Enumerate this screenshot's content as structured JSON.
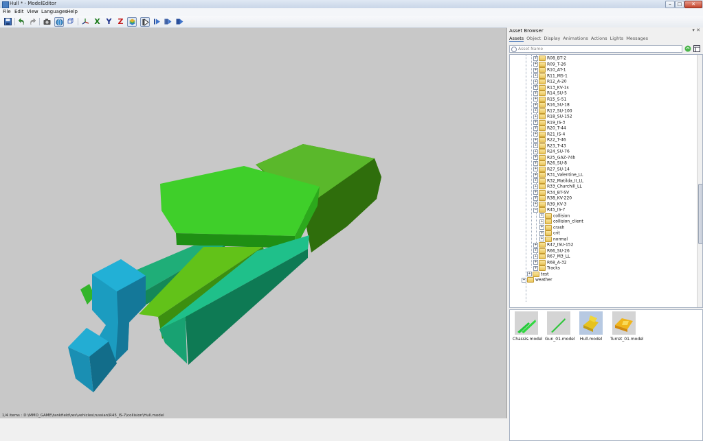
{
  "window": {
    "title": "Hull * - ModelEditor",
    "minimize": "–",
    "maximize": "□",
    "close": "✕"
  },
  "menu": [
    "File",
    "Edit",
    "View",
    "Languages",
    "Help"
  ],
  "toolbar": {
    "x_label": "X",
    "y_label": "Y",
    "z_label": "Z",
    "colors": {
      "x": "#1a7a1a",
      "y": "#1a2f8a",
      "z": "#c41a1a"
    }
  },
  "asset_browser": {
    "title": "Asset Browser",
    "header_buttons": "▾ ✕",
    "tabs": [
      "Assets",
      "Object",
      "Display",
      "Animations",
      "Actions",
      "Lights",
      "Messages"
    ],
    "active_tab": "Assets",
    "search_placeholder": "Asset Name",
    "tree": [
      "R08_BT-2",
      "R09_T-26",
      "R10_AT-1",
      "R11_MS-1",
      "R12_A-20",
      "R13_KV-1s",
      "R14_SU-5",
      "R15_S-51",
      "R16_SU-18",
      "R17_SU-100",
      "R18_SU-152",
      "R19_IS-3",
      "R20_T-44",
      "R21_IS-4",
      "R22_T-46",
      "R23_T-43",
      "R24_SU-76",
      "R25_GAZ-74b",
      "R26_SU-8",
      "R27_SU-14",
      "R31_Valentine_LL",
      "R32_Matilda_II_LL",
      "R33_Churchill_LL",
      "R34_BT-SV",
      "R38_KV-220",
      "R39_KV-3",
      "R45_IS-7"
    ],
    "tree_children": [
      "collision",
      "collision_client",
      "crash",
      "crit",
      "normal"
    ],
    "tree_after": [
      "R47_ISU-152",
      "R66_SU-26",
      "R67_M3_LL",
      "R68_A-32",
      "Tracks"
    ],
    "tree_tail": [
      "test",
      "weather"
    ],
    "thumbnails": [
      "Chassis.model",
      "Gun_01.model",
      "Hull.model",
      "Turret_01.model"
    ],
    "selected_thumbnail": "Hull.model",
    "status": "1/4 items : D:\\MMO_GAME\\tankfield\\res\\vehicles\\russian\\R45_IS-7\\collision\\Hull.model"
  }
}
